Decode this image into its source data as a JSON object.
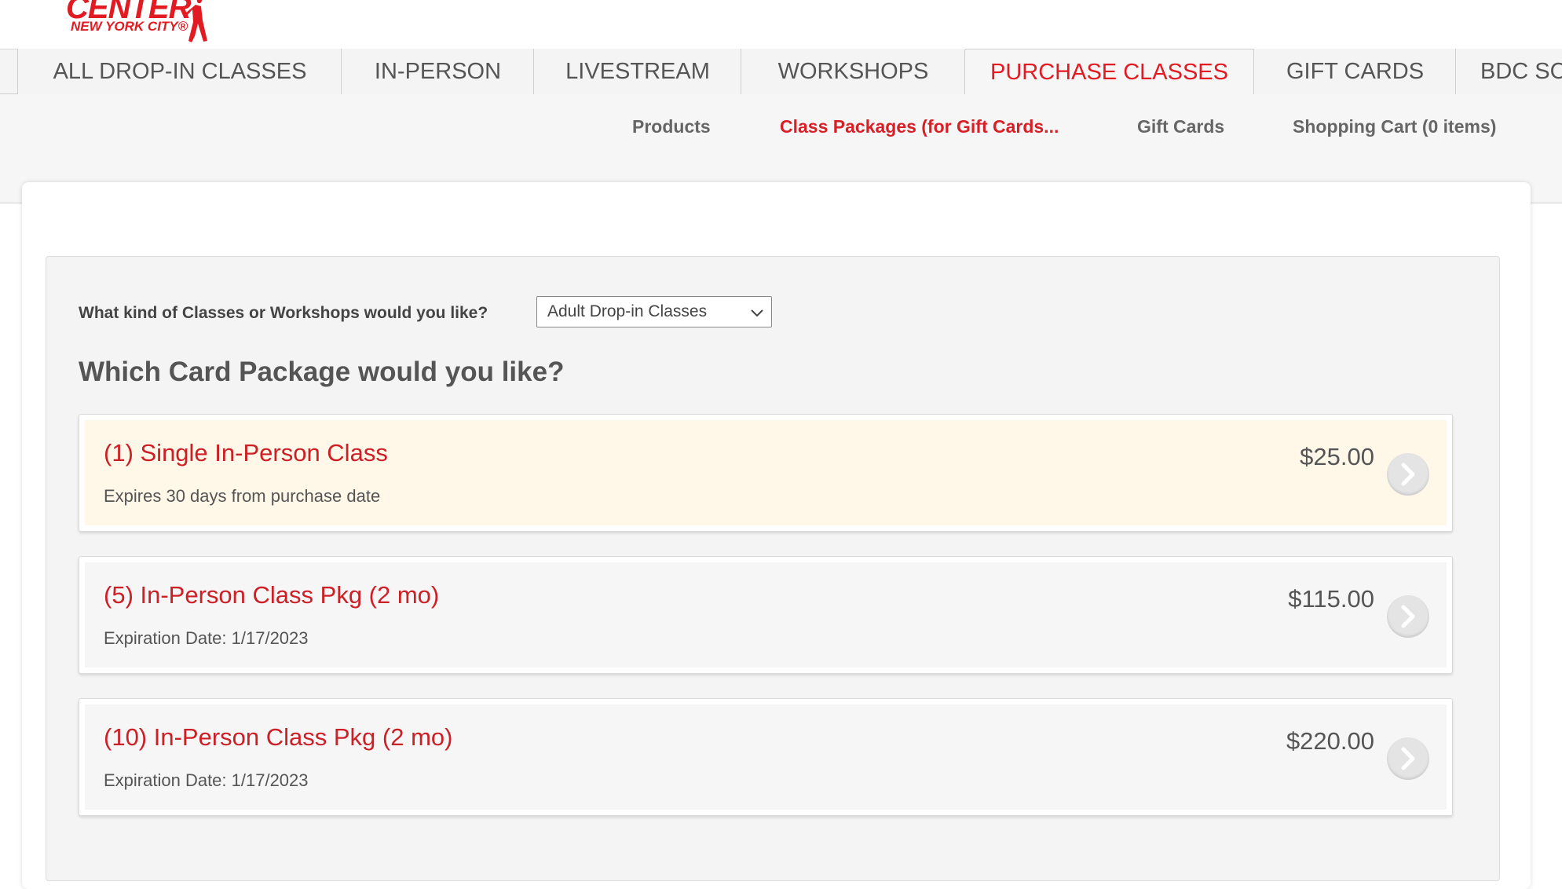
{
  "header": {
    "logo_main": "CENTER",
    "logo_sub": "NEW YORK CITY®"
  },
  "tabs": [
    {
      "label": "ALL DROP-IN CLASSES",
      "active": false
    },
    {
      "label": "IN-PERSON",
      "active": false
    },
    {
      "label": "LIVESTREAM",
      "active": false
    },
    {
      "label": "WORKSHOPS",
      "active": false
    },
    {
      "label": "PURCHASE CLASSES",
      "active": true
    },
    {
      "label": "GIFT CARDS",
      "active": false
    },
    {
      "label": "BDC SC",
      "active": false
    }
  ],
  "subnav": [
    {
      "label": "Products",
      "active": false
    },
    {
      "label": "Class Packages (for Gift Cards...",
      "active": true
    },
    {
      "label": "Gift Cards",
      "active": false
    },
    {
      "label": "Shopping Cart (0 items)",
      "active": false
    }
  ],
  "filter": {
    "question": "What kind of Classes or Workshops would you like?",
    "selected": "Adult Drop-in Classes"
  },
  "section_title": "Which Card Package would you like?",
  "packages": [
    {
      "name": "(1) Single In-Person Class",
      "desc": "Expires 30 days from purchase date",
      "price": "$25.00",
      "highlight": true
    },
    {
      "name": "(5) In-Person Class Pkg (2 mo)",
      "desc": "Expiration Date: 1/17/2023",
      "price": "$115.00",
      "highlight": false
    },
    {
      "name": "(10) In-Person Class Pkg (2 mo)",
      "desc": "Expiration Date: 1/17/2023",
      "price": "$220.00",
      "highlight": false
    }
  ],
  "colors": {
    "brand_red": "#e21a22",
    "highlight_bg": "#fff7e8"
  }
}
